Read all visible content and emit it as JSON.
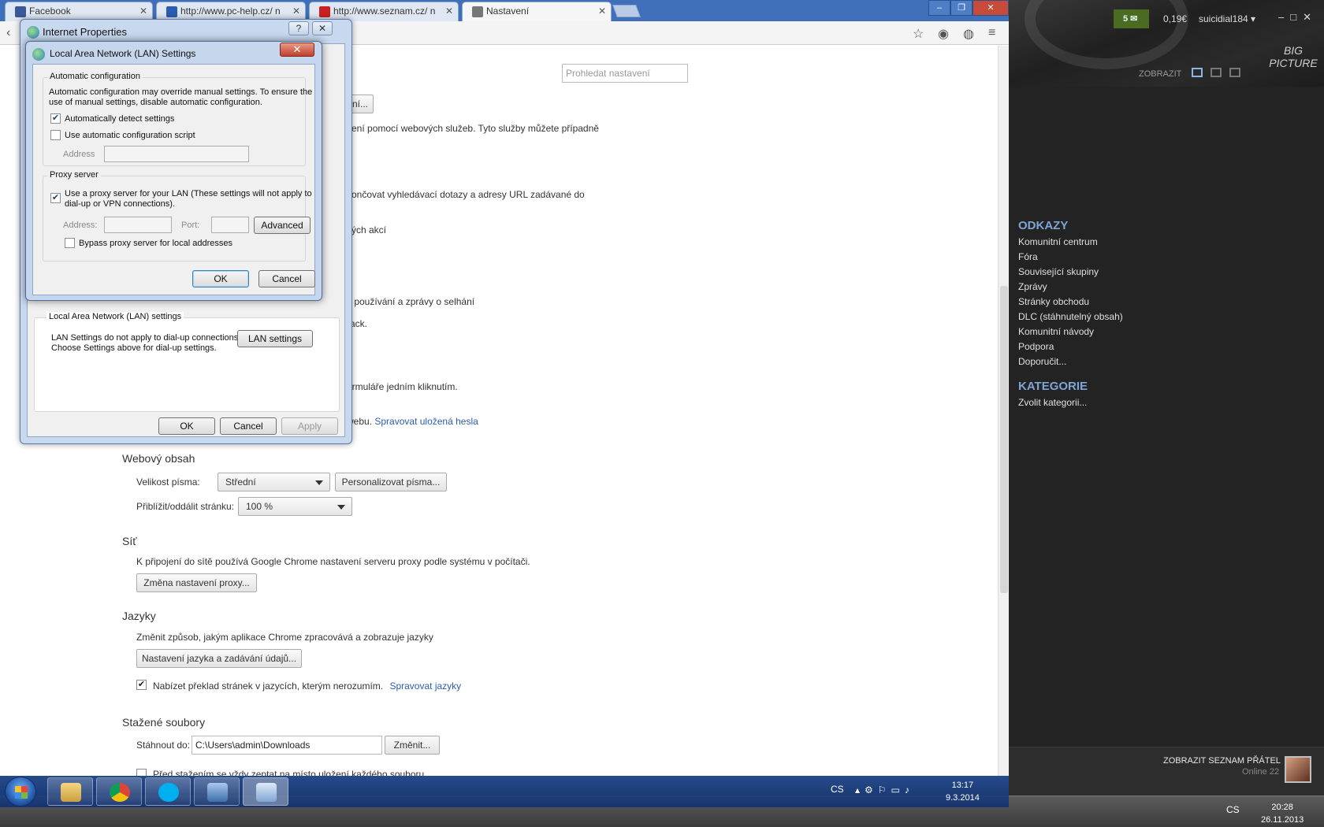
{
  "chrome": {
    "tabs": [
      {
        "title": "Facebook",
        "favicon_color": "#3b5998"
      },
      {
        "title": "http://www.pc-help.cz/ n",
        "favicon_color": "#2a5db0"
      },
      {
        "title": "http://www.seznam.cz/ n",
        "favicon_color": "#cc1f1f"
      },
      {
        "title": "Nastavení",
        "favicon_color": "#777777"
      }
    ],
    "search_placeholder": "Prohledat nastavení",
    "partial": {
      "btn1": "ní...",
      "line1": "žení pomocí webových služeb. Tyto služby můžete případně",
      "line2": "končovat vyhledávací dotazy a adresy URL zadávané do",
      "line3": "vých akcí",
      "line4": "y používání a zprávy o selhání",
      "line5": "rack.",
      "line6": "ormuláře jedním kliknutím.",
      "line7": "webu.",
      "link7": "Spravovat uložená hesla"
    },
    "web_content": {
      "heading": "Webový obsah",
      "font_size_label": "Velikost písma:",
      "font_size_value": "Střední",
      "customize_fonts": "Personalizovat písma...",
      "zoom_label": "Přiblížit/oddálit stránku:",
      "zoom_value": "100 %"
    },
    "network": {
      "heading": "Síť",
      "desc": "K připojení do sítě používá Google Chrome nastavení serveru proxy podle systému v počítači.",
      "button": "Změna nastavení proxy..."
    },
    "languages": {
      "heading": "Jazyky",
      "desc": "Změnit způsob, jakým aplikace Chrome zpracovává a zobrazuje jazyky",
      "button": "Nastavení jazyka a zadávání údajů...",
      "translate_label": "Nabízet překlad stránek v jazycích, kterým nerozumím.",
      "translate_link": "Spravovat jazyky",
      "translate_checked": true
    },
    "downloads": {
      "heading": "Stažené soubory",
      "label": "Stáhnout do:",
      "path": "C:\\Users\\admin\\Downloads",
      "button": "Změnit...",
      "ask_label": "Před stažením se vždy zeptat na místo uložení každého souboru"
    }
  },
  "internet_properties": {
    "title": "Internet Properties",
    "help": "?",
    "lan_group_title": "Local Area Network (LAN) settings",
    "lan_desc1": "LAN Settings do not apply to dial-up connections.",
    "lan_desc2": "Choose Settings above for dial-up settings.",
    "lan_button": "LAN settings",
    "ok": "OK",
    "cancel": "Cancel",
    "apply": "Apply"
  },
  "lan_dialog": {
    "title": "Local Area Network (LAN) Settings",
    "close": "✕",
    "auto_group": "Automatic configuration",
    "auto_desc1": "Automatic configuration may override manual settings.  To ensure the",
    "auto_desc2": "use of manual settings, disable automatic configuration.",
    "auto_detect": "Automatically detect settings",
    "auto_detect_checked": true,
    "use_script": "Use automatic configuration script",
    "use_script_checked": false,
    "address_label": "Address",
    "proxy_group": "Proxy server",
    "use_proxy1": "Use a proxy server for your LAN (These settings will not apply to",
    "use_proxy2": "dial-up or VPN connections).",
    "use_proxy_checked": true,
    "proxy_address_label": "Address:",
    "port_label": "Port:",
    "advanced": "Advanced",
    "bypass": "Bypass proxy server for local addresses",
    "bypass_checked": false,
    "ok": "OK",
    "cancel": "Cancel"
  },
  "steam": {
    "messages_count": "5",
    "wallet": "0,19€",
    "username": "suicidial184",
    "big_picture": "BIG PICTURE",
    "view_label": "ZOBRAZIT",
    "links_title": "ODKAZY",
    "links": [
      "Komunitní centrum",
      "Fóra",
      "Související skupiny",
      "Zprávy",
      "Stránky obchodu",
      "DLC (stáhnutelný obsah)",
      "Komunitní návody",
      "Podpora",
      "Doporučit..."
    ],
    "categories_title": "KATEGORIE",
    "categories_link": "Zvolit kategorii...",
    "friends_label": "ZOBRAZIT SEZNAM PŘÁTEL",
    "friends_online": "Online 22"
  },
  "taskbar": {
    "lang": "CS",
    "time": "13:17",
    "date": "9.3.2014",
    "lang2": "CS",
    "time2": "20:28",
    "date2": "26.11.2013"
  }
}
